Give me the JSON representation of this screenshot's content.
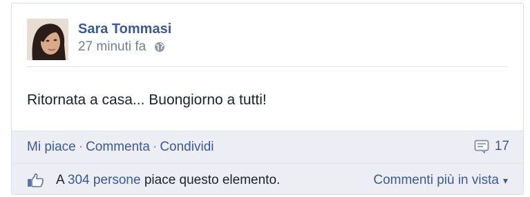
{
  "post": {
    "author": "Sara Tommasi",
    "time": "27 minuti fa",
    "privacy_icon": "globe-icon",
    "text": "Ritornata a casa... Buongiorno a tutti!"
  },
  "actions": {
    "like": "Mi piace",
    "separator": "·",
    "comment": "Commenta",
    "share": "Condividi",
    "comment_count": "17"
  },
  "likes": {
    "prefix": "A",
    "people_link": "304 persone",
    "suffix": "piace questo elemento."
  },
  "comments_sort": {
    "label": "Commenti più in vista",
    "caret": "▾"
  },
  "colors": {
    "link": "#3b5998",
    "footer_bg": "#eceef4",
    "meta_text": "#757f8d"
  }
}
